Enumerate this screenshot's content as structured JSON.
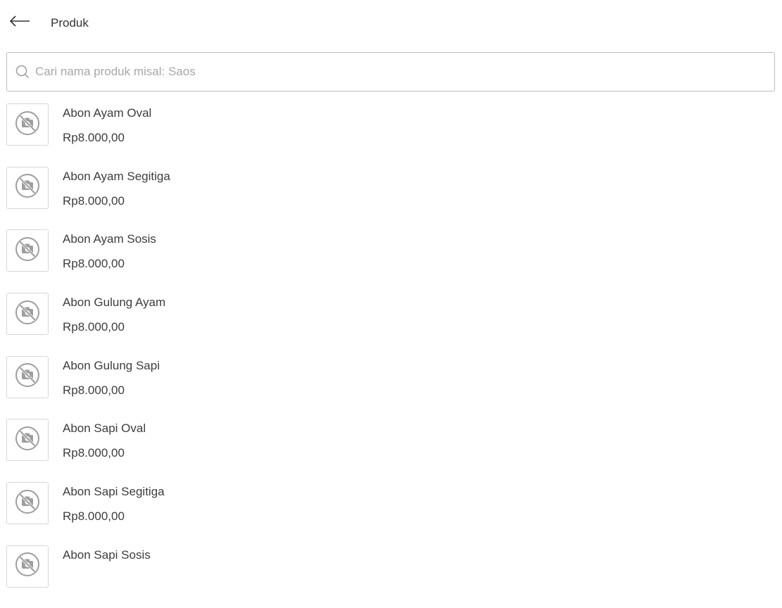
{
  "header": {
    "title": "Produk",
    "back_icon": "arrow-left-icon"
  },
  "search": {
    "placeholder": "Cari nama produk misal: Saos",
    "value": "",
    "icon": "search-icon"
  },
  "products": [
    {
      "name": "Abon Ayam Oval",
      "price": "Rp8.000,00",
      "image_icon": "no-photo-icon"
    },
    {
      "name": "Abon Ayam Segitiga",
      "price": "Rp8.000,00",
      "image_icon": "no-photo-icon"
    },
    {
      "name": "Abon Ayam Sosis",
      "price": "Rp8.000,00",
      "image_icon": "no-photo-icon"
    },
    {
      "name": "Abon Gulung Ayam",
      "price": "Rp8.000,00",
      "image_icon": "no-photo-icon"
    },
    {
      "name": "Abon Gulung Sapi",
      "price": "Rp8.000,00",
      "image_icon": "no-photo-icon"
    },
    {
      "name": "Abon Sapi Oval",
      "price": "Rp8.000,00",
      "image_icon": "no-photo-icon"
    },
    {
      "name": "Abon Sapi Segitiga",
      "price": "Rp8.000,00",
      "image_icon": "no-photo-icon"
    },
    {
      "name": "Abon Sapi Sosis",
      "price": "",
      "image_icon": "no-photo-icon"
    }
  ],
  "colors": {
    "text": "#3d3d3d",
    "placeholder": "#a8a8a8",
    "border": "#bdbdbd",
    "thumb_border": "#d6d6d6",
    "icon": "#9e9e9e"
  }
}
